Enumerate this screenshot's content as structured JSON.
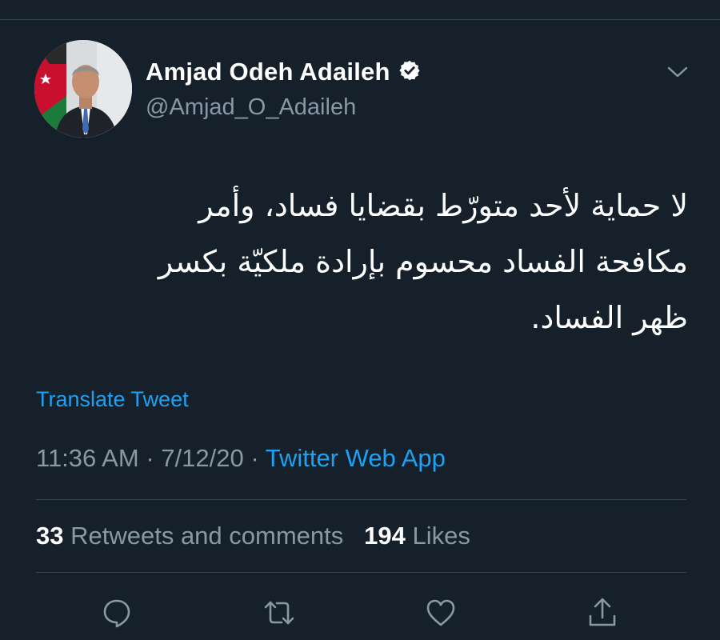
{
  "author": {
    "display_name": "Amjad Odeh Adaileh",
    "handle": "@Amjad_O_Adaileh",
    "verified": true,
    "avatar_icon": "profile-photo"
  },
  "tweet": {
    "lines": [
      "لا حماية لأحد متورّط بقضايا فساد، وأمر",
      "مكافحة الفساد محسوم بإرادة ملكيّة بكسر",
      "ظهر الفساد."
    ]
  },
  "translate_label": "Translate Tweet",
  "meta": {
    "time": "11:36 AM",
    "separator": "·",
    "date": "7/12/20",
    "source": "Twitter Web App"
  },
  "stats": {
    "retweets_count": "33",
    "retweets_label": "Retweets and comments",
    "likes_count": "194",
    "likes_label": "Likes"
  },
  "actions": {
    "icons": [
      "reply-icon",
      "retweet-icon",
      "like-icon",
      "share-icon"
    ]
  },
  "colors": {
    "background": "#15202b",
    "accent": "#1da1f2",
    "secondary_text": "#8899a6",
    "divider": "#38444d"
  }
}
